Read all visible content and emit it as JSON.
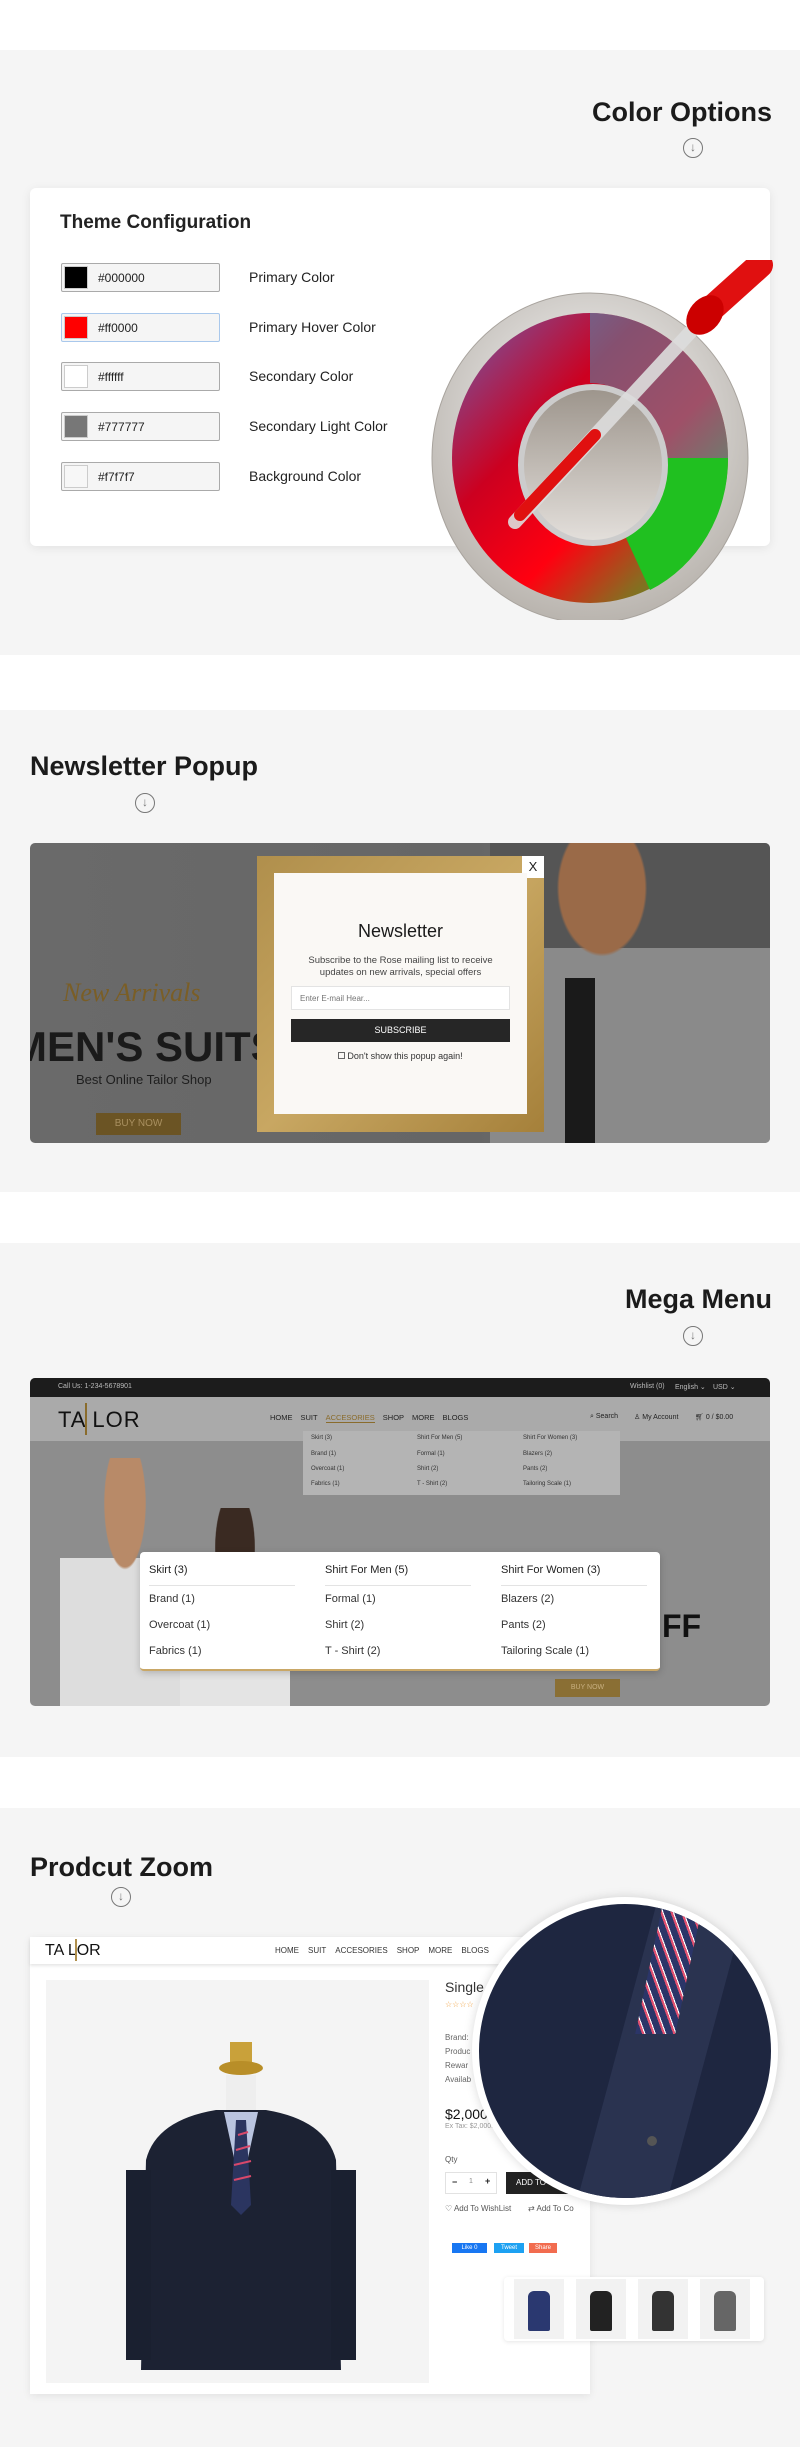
{
  "color_options": {
    "title": "Color Options",
    "card_title": "Theme Configuration",
    "rows": [
      {
        "value": "#000000",
        "label": "Primary Color",
        "swatch": "#000000"
      },
      {
        "value": "#ff0000",
        "label": "Primary Hover Color",
        "swatch": "#ff0000"
      },
      {
        "value": "#ffffff",
        "label": "Secondary Color",
        "swatch": "#ffffff"
      },
      {
        "value": "#777777",
        "label": "Secondary Light Color",
        "swatch": "#777777"
      },
      {
        "value": "#f7f7f7",
        "label": "Background Color",
        "swatch": "#f7f7f7"
      }
    ]
  },
  "newsletter": {
    "title": "Newsletter Popup",
    "banner_script": "New Arrivals",
    "banner_title": "MEN'S SUITS",
    "banner_subtitle": "Best Online Tailor Shop",
    "banner_button": "BUY NOW",
    "popup": {
      "title": "Newsletter",
      "text_line1": "Subscribe to the Rose mailing list to receive",
      "text_line2": "updates on new arrivals, special offers",
      "placeholder": "Enter E-mail Hear...",
      "button": "SUBSCRIBE",
      "checkbox_label": "Don't show this popup again!",
      "close": "X"
    }
  },
  "mega_menu": {
    "title": "Mega Menu",
    "topbar": {
      "phone": "Call Us: 1-234-5678901",
      "wishlist": "Wishlist (0)",
      "language": "English ⌄",
      "currency": "USD ⌄"
    },
    "logo": "TA LOR",
    "nav": [
      "HOME",
      "SUIT",
      "ACCESORIES",
      "SHOP",
      "MORE",
      "BLOGS"
    ],
    "active_nav": "ACCESORIES",
    "search": "Search",
    "account": "My Account",
    "cart": "0 / $0.00",
    "columns": [
      {
        "head": "Skirt (3)",
        "items": [
          "Brand (1)",
          "Overcoat (1)",
          "Fabrics (1)"
        ]
      },
      {
        "head": "Shirt For Men (5)",
        "items": [
          "Formal (1)",
          "Shirt (2)",
          "T - Shirt (2)"
        ]
      },
      {
        "head": "Shirt For Women (3)",
        "items": [
          "Blazers (2)",
          "Pants (2)",
          "Tailoring Scale (1)"
        ]
      }
    ],
    "banner_text": "FF",
    "banner_button": "BUY NOW"
  },
  "product_zoom": {
    "title": "Prodcut Zoom",
    "logo": "TA LOR",
    "nav": [
      "HOME",
      "SUIT",
      "ACCESORIES",
      "SHOP",
      "MORE",
      "BLOGS"
    ],
    "product_title": "Single",
    "details": [
      "Brand:",
      "Produc",
      "Rewar",
      "Availab"
    ],
    "price": "$2,000.",
    "ex_tax": "Ex Tax: $2,000.",
    "qty_label": "Qty",
    "qty": "1",
    "minus": "−",
    "plus": "+",
    "add_to_cart": "ADD TO C",
    "wishlist": "Add To WishList",
    "compare": "Add To Co",
    "social": [
      "Like 0",
      "Tweet",
      "Share"
    ],
    "rating": 4
  },
  "colors": {
    "gold": "#a5803a",
    "dark": "#222222",
    "section_bg": "#f5f5f5"
  }
}
